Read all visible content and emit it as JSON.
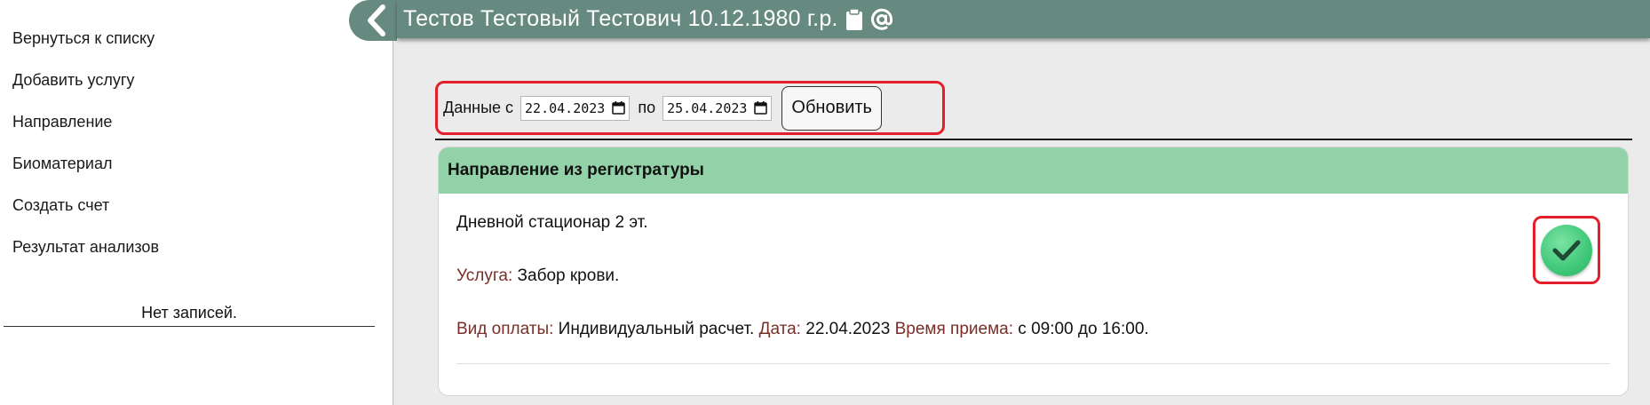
{
  "sidebar": {
    "items": [
      {
        "label": "Вернуться к списку"
      },
      {
        "label": "Добавить услугу"
      },
      {
        "label": "Направление"
      },
      {
        "label": "Биоматериал"
      },
      {
        "label": "Создать счет"
      },
      {
        "label": "Результат анализов"
      }
    ],
    "empty_text": "Нет записей."
  },
  "header": {
    "patient": "Тестов Тестовый Тестович 10.12.1980 г.р.",
    "icons": [
      "chevron-left-icon",
      "clipboard-icon",
      "at-sign-icon"
    ]
  },
  "filter": {
    "from_label": "Данные с",
    "from_value": "22.04.2023",
    "to_label": "по",
    "to_value": "25.04.2023",
    "refresh_label": "Обновить"
  },
  "card": {
    "title": "Направление из регистратуры",
    "department": "Дневной стационар 2 эт.",
    "service_label": "Услуга:",
    "service_value": "Забор крови.",
    "payment_label": "Вид оплаты:",
    "payment_value": "Индивидуальный расчет.",
    "date_label": "Дата:",
    "date_value": "22.04.2023",
    "time_label": "Время приема:",
    "time_value": "с 09:00 до 16:00.",
    "confirm_icon": "checkmark-icon"
  },
  "colors": {
    "header_bg": "#678a80",
    "card_header_bg": "#93d2a8",
    "highlight_border": "#e41e2a",
    "label_color": "#7a2e28",
    "confirm_green": "#3fc878"
  }
}
